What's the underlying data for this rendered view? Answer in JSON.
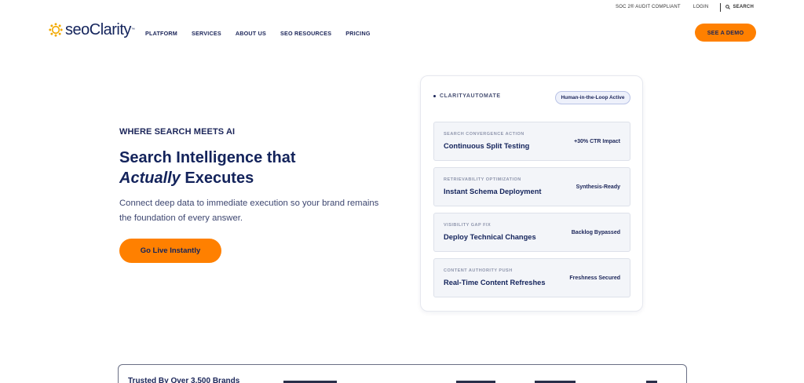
{
  "utility": {
    "soc": "SOC 2® AUDIT COMPLIANT",
    "login": "LOGIN",
    "search": "SEARCH"
  },
  "brand": {
    "logo_text": "seoClarity",
    "tm": "™",
    "accent": "#ff8000",
    "navy": "#13235b"
  },
  "nav": {
    "items": [
      "PLATFORM",
      "SERVICES",
      "ABOUT US",
      "SEO RESOURCES",
      "PRICING"
    ],
    "demo": "SEE A DEMO"
  },
  "hero": {
    "eyebrow": "WHERE SEARCH MEETS AI",
    "headline_line1": "Search Intelligence that",
    "headline_em": "Actually",
    "headline_rest": " Executes",
    "subtext": "Connect deep data to immediate execution so your brand remains the foundation of every answer.",
    "cta": "Go Live Instantly"
  },
  "automate": {
    "label": "CLARITYAUTOMATE",
    "badge": "Human-in-the-Loop Active",
    "rows": [
      {
        "tag": "SEARCH CONVERGENCE ACTION",
        "title": "Continuous Split Testing",
        "status": "+30% CTR Impact"
      },
      {
        "tag": "RETRIEVABILITY OPTIMIZATION",
        "title": "Instant Schema Deployment",
        "status": "Synthesis-Ready"
      },
      {
        "tag": "VISIBILITY GAP FIX",
        "title": "Deploy Technical Changes",
        "status": "Backlog Bypassed"
      },
      {
        "tag": "CONTENT AUTHORITY PUSH",
        "title": "Real-Time Content Refreshes",
        "status": "Freshness Secured"
      }
    ]
  },
  "trusted": {
    "label": "Trusted By Over 3,500 Brands"
  }
}
